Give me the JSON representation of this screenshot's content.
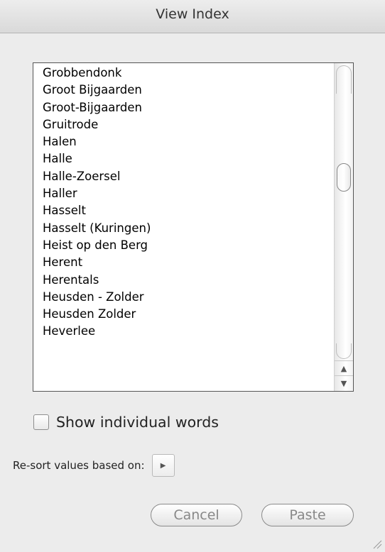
{
  "window": {
    "title": "View Index"
  },
  "list": {
    "items": [
      "Grobbendonk",
      "Groot Bijgaarden",
      "Groot-Bijgaarden",
      "Gruitrode",
      "Halen",
      "Halle",
      "Halle-Zoersel",
      "Haller",
      "Hasselt",
      "Hasselt (Kuringen)",
      "Heist op den Berg",
      "Herent",
      "Herentals",
      "Heusden - Zolder",
      "Heusden Zolder",
      "Heverlee"
    ],
    "scroll_position": 0.33
  },
  "options": {
    "show_words_label": "Show individual words",
    "show_words_checked": false,
    "resort_label": "Re-sort values based on:"
  },
  "buttons": {
    "cancel_label": "Cancel",
    "paste_label": "Paste"
  },
  "icons": {
    "scroll_up": "▲",
    "scroll_down": "▼",
    "popup_arrow": "▶"
  }
}
